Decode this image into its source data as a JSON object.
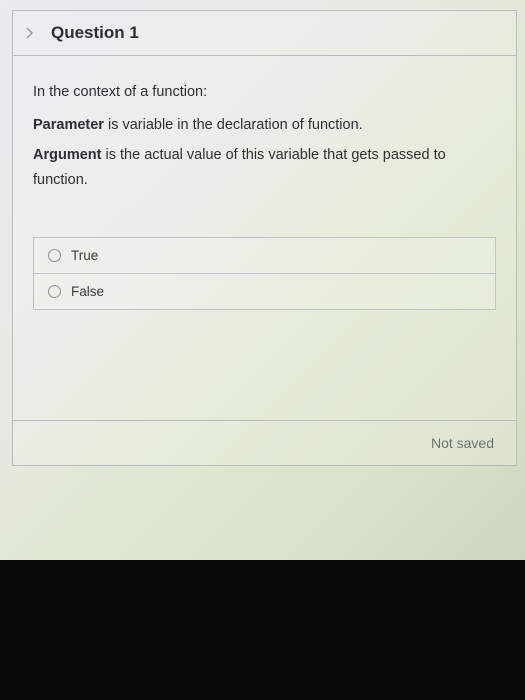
{
  "question": {
    "title": "Question 1",
    "context": "In the context of a function:",
    "line_param_bold": "Parameter",
    "line_param_rest": " is variable in the declaration of function.",
    "line_arg_bold": "Argument",
    "line_arg_rest": " is the actual value of this variable that gets passed to function.",
    "options": {
      "opt_true": "True",
      "opt_false": "False"
    },
    "status": "Not saved"
  }
}
